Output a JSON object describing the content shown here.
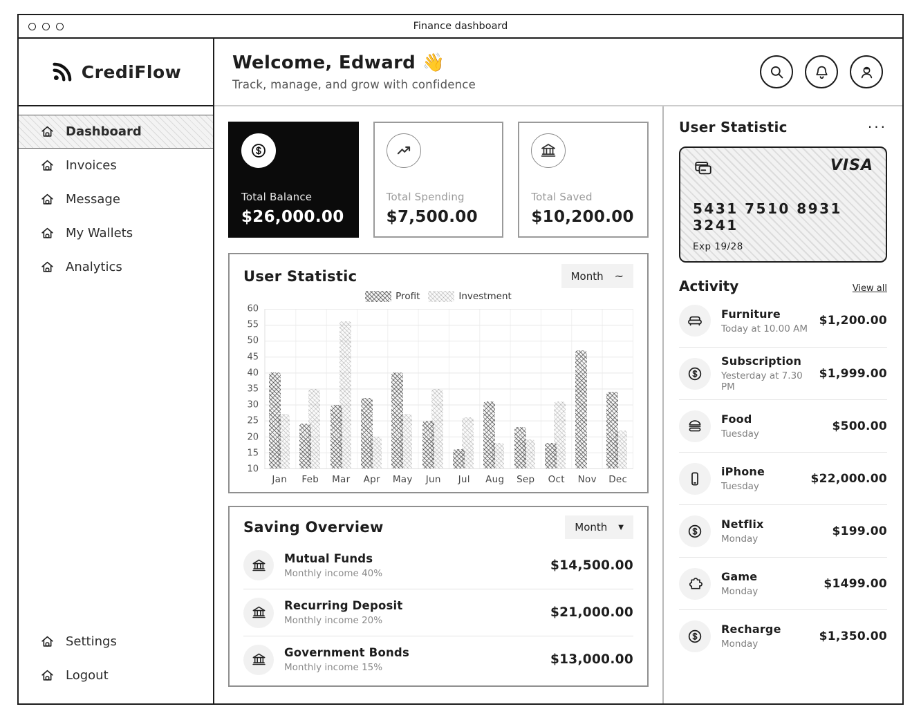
{
  "window": {
    "title": "Finance dashboard"
  },
  "sidebar": {
    "brand": "CrediFlow",
    "items": [
      {
        "label": "Dashboard",
        "active": true
      },
      {
        "label": "Invoices",
        "active": false
      },
      {
        "label": "Message",
        "active": false
      },
      {
        "label": "My Wallets",
        "active": false
      },
      {
        "label": "Analytics",
        "active": false
      }
    ],
    "footer_items": [
      {
        "label": "Settings"
      },
      {
        "label": "Logout"
      }
    ]
  },
  "header": {
    "greeting": "Welcome, Edward",
    "wave_emoji": "👋",
    "subtitle": "Track, manage, and grow with confidence",
    "icons": [
      "search-icon",
      "bell-icon",
      "avatar-icon"
    ]
  },
  "summary_cards": [
    {
      "label": "Total Balance",
      "value": "$26,000.00",
      "icon": "dollar-icon",
      "variant": "dark"
    },
    {
      "label": "Total Spending",
      "value": "$7,500.00",
      "icon": "trend-up-icon",
      "variant": "light"
    },
    {
      "label": "Total Saved",
      "value": "$10,200.00",
      "icon": "bank-icon",
      "variant": "light"
    }
  ],
  "chart_panel": {
    "title": "User Statistic",
    "period_label": "Month"
  },
  "chart_data": {
    "type": "bar",
    "title": "User Statistic",
    "categories": [
      "Jan",
      "Feb",
      "Mar",
      "Apr",
      "May",
      "Jun",
      "Jul",
      "Aug",
      "Sep",
      "Oct",
      "Nov",
      "Dec"
    ],
    "series": [
      {
        "name": "Profit",
        "values": [
          40,
          24,
          30,
          32,
          40,
          25,
          16,
          31,
          23,
          18,
          47,
          34
        ]
      },
      {
        "name": "Investment",
        "values": [
          27,
          35,
          56,
          20,
          27,
          35,
          26,
          18,
          19,
          31,
          10,
          22
        ]
      }
    ],
    "xlabel": "",
    "ylabel": "",
    "ylim": [
      10,
      60
    ],
    "ytick_step": 5,
    "yticks": [
      10,
      15,
      20,
      25,
      30,
      35,
      40,
      45,
      50,
      55,
      60
    ],
    "grid": true,
    "legend_position": "top",
    "bar_baseline": 10
  },
  "saving_overview": {
    "title": "Saving Overview",
    "period_label": "Month",
    "rows": [
      {
        "name": "Mutual Funds",
        "subtitle": "Monthly income 40%",
        "amount": "$14,500.00",
        "icon": "bank-icon"
      },
      {
        "name": "Recurring Deposit",
        "subtitle": "Monthly income 20%",
        "amount": "$21,000.00",
        "icon": "bank-icon"
      },
      {
        "name": "Government Bonds",
        "subtitle": "Monthly income 15%",
        "amount": "$13,000.00",
        "icon": "bank-icon"
      }
    ]
  },
  "right_panel": {
    "title": "User Statistic",
    "card": {
      "brand": "VISA",
      "number": "5431 7510 8931 3241",
      "expiry": "Exp 19/28",
      "icon": "cards-icon"
    },
    "activity": {
      "title": "Activity",
      "view_all": "View all",
      "items": [
        {
          "name": "Furniture",
          "time": "Today at 10.00 AM",
          "amount": "$1,200.00",
          "icon": "sofa-icon"
        },
        {
          "name": "Subscription",
          "time": "Yesterday at 7.30 PM",
          "amount": "$1,999.00",
          "icon": "dollar-icon"
        },
        {
          "name": "Food",
          "time": "Tuesday",
          "amount": "$500.00",
          "icon": "burger-icon"
        },
        {
          "name": "iPhone",
          "time": "Tuesday",
          "amount": "$22,000.00",
          "icon": "phone-icon"
        },
        {
          "name": "Netflix",
          "time": "Monday",
          "amount": "$199.00",
          "icon": "dollar-icon"
        },
        {
          "name": "Game",
          "time": "Monday",
          "amount": "$1499.00",
          "icon": "puzzle-icon"
        },
        {
          "name": "Recharge",
          "time": "Monday",
          "amount": "$1,350.00",
          "icon": "dollar-icon"
        }
      ]
    }
  },
  "colors": {
    "accent": "#1c1c1c",
    "dark_card_bg": "#0b0b0b",
    "panel_border": "#8f8f8f",
    "muted_text": "#8a8a8a",
    "hatch_gray": "#dcdcdc",
    "wave_yellow": "#f0b429"
  }
}
